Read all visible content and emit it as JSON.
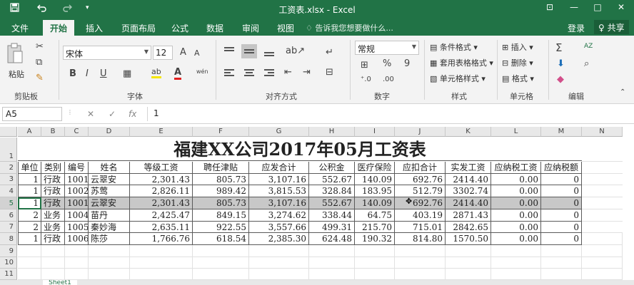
{
  "window": {
    "title": "工资表.xlsx - Excel",
    "save_icon": "save-icon",
    "undo_icon": "undo-icon",
    "redo_icon": "redo-icon",
    "qa_more": "▾",
    "min": "—",
    "max": "□",
    "close": "✕",
    "ribbon_display": "⊡"
  },
  "ribbon_tabs": [
    "文件",
    "开始",
    "插入",
    "页面布局",
    "公式",
    "数据",
    "审阅",
    "视图"
  ],
  "tell_me": "告诉我您想要做什么...",
  "login": "登录",
  "share": "♀ 共享",
  "ribbon": {
    "clipboard": {
      "paste": "粘贴",
      "label": "剪贴板"
    },
    "font": {
      "name": "宋体",
      "size": "12",
      "bold": "B",
      "italic": "I",
      "underline": "U",
      "grow": "A",
      "shrink": "A",
      "font_color": "A",
      "highlight": "ab",
      "wen": "wén",
      "label": "字体"
    },
    "alignment": {
      "label": "对齐方式"
    },
    "number": {
      "format": "常规",
      "percent": "%",
      "comma": "9",
      "label": "数字"
    },
    "styles": {
      "conditional": "条件格式",
      "table": "套用表格格式",
      "cell": "单元格样式",
      "label": "样式"
    },
    "cells": {
      "insert": "插入",
      "delete": "删除",
      "format": "格式",
      "label": "单元格"
    },
    "editing": {
      "sum": "Σ",
      "sort": "AZ",
      "find": "⌕",
      "label": "编辑"
    }
  },
  "formula_bar": {
    "name_box": "A5",
    "cancel": "✕",
    "enter": "✓",
    "fx": "fx",
    "value": "1"
  },
  "columns": [
    "A",
    "B",
    "C",
    "D",
    "E",
    "F",
    "G",
    "H",
    "I",
    "J",
    "K",
    "L",
    "M",
    "N"
  ],
  "rows": [
    "1",
    "2",
    "3",
    "4",
    "5",
    "6",
    "7",
    "8",
    "9",
    "10",
    "11"
  ],
  "sheet": {
    "title": "福建XX公司2017年05月工资表",
    "headers": [
      "单位",
      "类别",
      "编号",
      "姓名",
      "等级工资",
      "聘任津贴",
      "应发合计",
      "公积金",
      "医疗保险",
      "应扣合计",
      "实发工资",
      "应纳税工资",
      "应纳税额"
    ],
    "data": [
      [
        "1",
        "行政",
        "1001",
        "云翠安",
        "2,301.43",
        "805.73",
        "3,107.16",
        "552.67",
        "140.09",
        "692.76",
        "2414.40",
        "0.00",
        "0"
      ],
      [
        "1",
        "行政",
        "1002",
        "苏莺",
        "2,826.11",
        "989.42",
        "3,815.53",
        "328.84",
        "183.95",
        "512.79",
        "3302.74",
        "0.00",
        "0"
      ],
      [
        "1",
        "行政",
        "1001",
        "云翠安",
        "2,301.43",
        "805.73",
        "3,107.16",
        "552.67",
        "140.09",
        "692.76",
        "2414.40",
        "0.00",
        "0"
      ],
      [
        "2",
        "业务",
        "1004",
        "苗丹",
        "2,425.47",
        "849.15",
        "3,274.62",
        "338.44",
        "64.75",
        "403.19",
        "2871.43",
        "0.00",
        "0"
      ],
      [
        "2",
        "业务",
        "1005",
        "秦妙海",
        "2,635.11",
        "922.55",
        "3,557.66",
        "499.31",
        "215.70",
        "715.01",
        "2842.65",
        "0.00",
        "0"
      ],
      [
        "1",
        "行政",
        "1006",
        "陈莎",
        "1,766.76",
        "618.54",
        "2,385.30",
        "624.48",
        "190.32",
        "814.80",
        "1570.50",
        "0.00",
        "0"
      ]
    ]
  },
  "sheet_tabs": [
    "Sheet1"
  ]
}
